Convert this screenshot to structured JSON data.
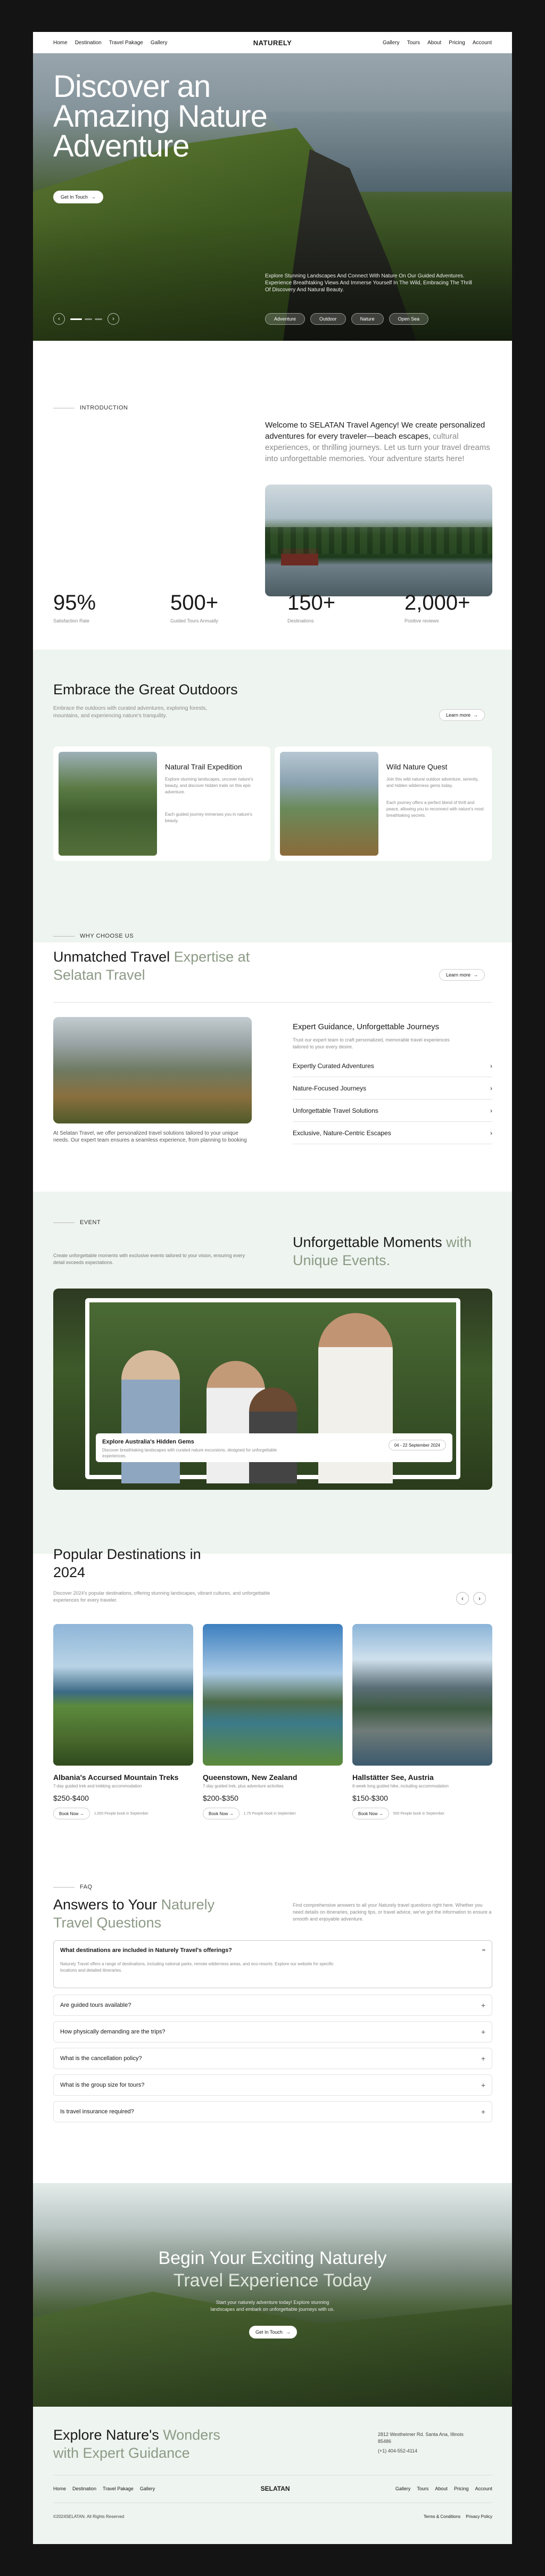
{
  "nav": {
    "left": [
      "Home",
      "Destination",
      "Travel Pakage",
      "Gallery"
    ],
    "brand": "NATURELY",
    "right": [
      "Gallery",
      "Tours",
      "About",
      "Pricing",
      "Account"
    ]
  },
  "hero": {
    "title": "Discover an Amazing Nature Adventure",
    "cta": "Get In Touch",
    "cta_icon": "arrow-right",
    "description": "Explore Stunning Landscapes And Connect With Nature On Our Guided Adventures. Experience Breathtaking Views And Immerse Yourself In The Wild, Embracing The Thrill Of Discovery And Natural Beauty.",
    "chips": [
      "Adventure",
      "Outdoor",
      "Nature",
      "Open Sea"
    ],
    "prev_icon": "chevron-left",
    "next_icon": "chevron-right"
  },
  "intro": {
    "label": "INTRODUCTION",
    "lead": "Welcome to SELATAN Travel Agency! We create personalized adventures for every traveler—beach escapes,",
    "lead_soft": "cultural experiences, or thrilling journeys. Let us turn your travel dreams into unforgettable memories. Your adventure starts here!"
  },
  "stats": [
    {
      "value": "95%",
      "label": "Satisfaction Rate"
    },
    {
      "value": "500+",
      "label": "Guided Tours Annually"
    },
    {
      "value": "150+",
      "label": "Destinations"
    },
    {
      "value": "2,000+",
      "label": "Positive reviews"
    }
  ],
  "outdoors": {
    "title": "Embrace the Great Outdoors",
    "desc": "Embrace the outdoors with curated adventures, exploring forests, mountains, and experiencing nature's tranquility.",
    "learn": "Learn more",
    "cards": [
      {
        "title": "Natural Trail Expedition",
        "desc": "Explore stunning landscapes, uncover nature's beauty, and discover hidden trails on this epic adventure.",
        "note": "Each guided journey immerses you in nature's beauty."
      },
      {
        "title": "Wild Nature Quest",
        "desc": "Join this wild natural outdoor adventure, serenity, and hidden wilderness gems today.",
        "note": "Each journey offers a perfect blend of thrill and peace, allowing you to reconnect with nature's most breathtaking secrets."
      }
    ]
  },
  "why": {
    "label": "WHY CHOOSE US",
    "title_a": "Unmatched Travel",
    "title_b": "Expertise at Selatan Travel",
    "learn": "Learn more",
    "caption": "At Selatan Travel, we offer personalized travel solutions tailored to your unique needs. Our expert team ensures a seamless experience, from planning to booking",
    "expert_title": "Expert Guidance, Unforgettable Journeys",
    "expert_desc": "Trust our expert team to craft personalized, memorable travel experiences tailored to your every desire.",
    "items": [
      "Expertly Curated Adventures",
      "Nature-Focused Journeys",
      "Unforgettable Travel Solutions",
      "Exclusive, Nature-Centric Escapes"
    ]
  },
  "event": {
    "label": "EVENT",
    "desc": "Create unforgettable moments with exclusive events tailored to your vision, ensuring every detail exceeds expectations.",
    "title_a": "Unforgettable Moments",
    "title_b": "with Unique Events.",
    "card_title": "Explore Australia's Hidden Gems",
    "card_desc": "Discover breathtaking landscapes with curated nature excursions, designed for unforgettable experiences.",
    "card_date": "04 - 22 September 2024"
  },
  "destinations": {
    "title": "Popular Destinations in 2024",
    "desc": "Discover 2024's popular destinations, offering stunning landscapes, vibrant cultures, and unforgettable experiences for every traveler.",
    "items": [
      {
        "title": "Albania's Accursed Mountain Treks",
        "sub": "7-day guided trek and trekking accommodation",
        "price": "$250-$400",
        "book": "Book Now",
        "note": "1,000 People book in September"
      },
      {
        "title": "Queenstown, New Zealand",
        "sub": "7-day guided trek, plus adventure activities",
        "price": "$200-$350",
        "book": "Book Now",
        "note": "1,75 People book in September"
      },
      {
        "title": "Hallstätter See, Austria",
        "sub": "6-week long guided hike, including accommodation",
        "price": "$150-$300",
        "book": "Book Now",
        "note": "500 People book in September"
      }
    ]
  },
  "faq": {
    "label": "FAQ",
    "title_a": "Answers to Your",
    "title_b": "Naturely Travel Questions",
    "desc": "Find comprehensive answers to all your Naturely travel questions right here. Whether you need details on itineraries, packing tips, or travel advice, we've got the information to ensure a smooth and enjoyable adventure.",
    "open_q": "What destinations are included in Naturely Travel's offerings?",
    "open_a": "Naturely Travel offers a range of destinations, including national parks, remote wilderness areas, and eco-resorts. Explore our website for specific locations and detailed itineraries.",
    "items": [
      "Are guided tours available?",
      "How physically demanding are the trips?",
      "What is the cancellation policy?",
      "What is the group size for tours?",
      "Is travel insurance required?"
    ]
  },
  "cta_banner": {
    "title_a": "Begin Your Exciting Naturely",
    "title_b": "Travel Experience Today",
    "desc": "Start your naturely adventure today! Explore stunning landscapes and embark on unforgettable journeys with us.",
    "button": "Get In Touch"
  },
  "footer": {
    "title_a": "Explore Nature's",
    "title_a2": "Wonders",
    "title_b": "with Expert Guidance",
    "address": "2812 Westheimer Rd. Santa Ana, Illinois 85486",
    "phone": "(+1) 404-552-4114",
    "nav_left": [
      "Home",
      "Destination",
      "Travel Pakage",
      "Gallery"
    ],
    "brand": "SELATAN",
    "nav_right": [
      "Gallery",
      "Tours",
      "About",
      "Pricing",
      "Account"
    ],
    "copyright": "©2024SELATAN. All Rights Reserved",
    "links": [
      "Terms & Conditions",
      "Privacy Policy"
    ]
  }
}
